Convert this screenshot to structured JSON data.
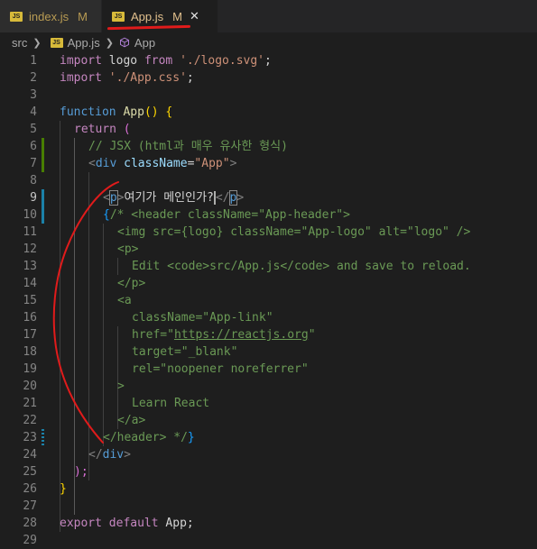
{
  "tabs": [
    {
      "name": "index.js",
      "badge": "M",
      "icon": "js-file-icon",
      "active": false
    },
    {
      "name": "App.js",
      "badge": "M",
      "icon": "js-file-icon",
      "active": true,
      "close": "✕"
    }
  ],
  "breadcrumb": {
    "folder": "src",
    "file": "App.js",
    "symbol": "App"
  },
  "icon_label": "JS",
  "lines": [
    {
      "n": "1"
    },
    {
      "n": "2"
    },
    {
      "n": "3"
    },
    {
      "n": "4"
    },
    {
      "n": "5"
    },
    {
      "n": "6"
    },
    {
      "n": "7"
    },
    {
      "n": "8"
    },
    {
      "n": "9"
    },
    {
      "n": "10"
    },
    {
      "n": "11"
    },
    {
      "n": "12"
    },
    {
      "n": "13"
    },
    {
      "n": "14"
    },
    {
      "n": "15"
    },
    {
      "n": "16"
    },
    {
      "n": "17"
    },
    {
      "n": "18"
    },
    {
      "n": "19"
    },
    {
      "n": "20"
    },
    {
      "n": "21"
    },
    {
      "n": "22"
    },
    {
      "n": "23"
    },
    {
      "n": "24"
    },
    {
      "n": "25"
    },
    {
      "n": "26"
    },
    {
      "n": "27"
    },
    {
      "n": "28"
    },
    {
      "n": "29"
    }
  ],
  "code": {
    "l1": {
      "kw": "import",
      "id": " logo ",
      "from": "from",
      "str": "'./logo.svg'",
      "semi": ";"
    },
    "l2": {
      "kw": "import",
      "str": "'./App.css'",
      "semi": ";"
    },
    "l4": {
      "kw": "function",
      "fn": "App",
      "rest": "() {"
    },
    "l5": {
      "kw": "return",
      "rest": " ("
    },
    "l6": {
      "com": "// JSX (html과 매우 유사한 형식)"
    },
    "l7": {
      "open": "<",
      "tag": "div",
      "attr": "className",
      "eq": "=",
      "str": "\"App\"",
      "close": ">"
    },
    "l9": {
      "open": "<",
      "tag": "p",
      "close": ">",
      "text": "여기가 메인인가?",
      "endopen": "</",
      "endtag": "p",
      "endclose": ">"
    },
    "l10": {
      "brace": "{",
      "com": "/* <header className=\"App-header\">"
    },
    "l11": {
      "com": "<img src={logo} className=\"App-logo\" alt=\"logo\" />"
    },
    "l12": {
      "com": "<p>"
    },
    "l13": {
      "com": "Edit <code>src/App.js</code> and save to reload."
    },
    "l14": {
      "com": "</p>"
    },
    "l15": {
      "com": "<a"
    },
    "l16": {
      "com": "className=\"App-link\""
    },
    "l17": {
      "pre": "href=\"",
      "url": "https://reactjs.org",
      "post": "\""
    },
    "l18": {
      "com": "target=\"_blank\""
    },
    "l19": {
      "com": "rel=\"noopener noreferrer\""
    },
    "l20": {
      "com": ">"
    },
    "l21": {
      "com": "Learn React"
    },
    "l22": {
      "com": "</a>"
    },
    "l23": {
      "com": "</header> */",
      "brace": "}"
    },
    "l24": {
      "open": "</",
      "tag": "div",
      "close": ">"
    },
    "l25": {
      "rest": ");"
    },
    "l26": {
      "rest": "}"
    },
    "l28": {
      "kw": "export",
      "kw2": "default",
      "id": " App",
      "semi": ";"
    }
  },
  "colors": {
    "annotation": "#e01b1b",
    "git_added": "#487e02",
    "git_modified": "#1b81a8"
  }
}
